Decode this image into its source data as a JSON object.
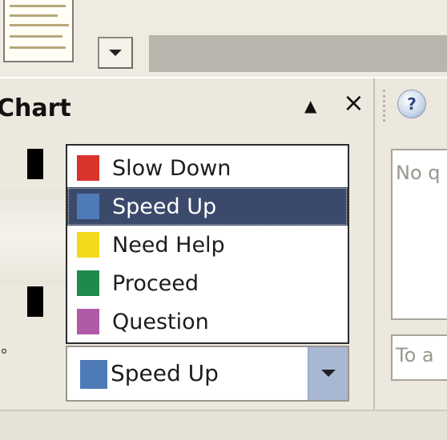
{
  "panel": {
    "title": "Chart",
    "collapse_symbol": "▲",
    "close_symbol": "×"
  },
  "dropdown": {
    "options": [
      {
        "label": "Slow Down",
        "color": "#d9342b"
      },
      {
        "label": "Speed Up",
        "color": "#4f7ab8",
        "selected": true
      },
      {
        "label": "Need Help",
        "color": "#f2d91c"
      },
      {
        "label": "Proceed",
        "color": "#1f8a4c"
      },
      {
        "label": "Question",
        "color": "#b05aa8"
      }
    ]
  },
  "combo": {
    "value": "Speed Up",
    "color": "#4f7ab8",
    "arrow_icon": "chevron-down-icon"
  },
  "right_panel": {
    "help_icon": "help-icon",
    "help_glyph": "?",
    "questions_placeholder": "No q",
    "ask_placeholder": "To a"
  },
  "left_edge_glyph": "°"
}
